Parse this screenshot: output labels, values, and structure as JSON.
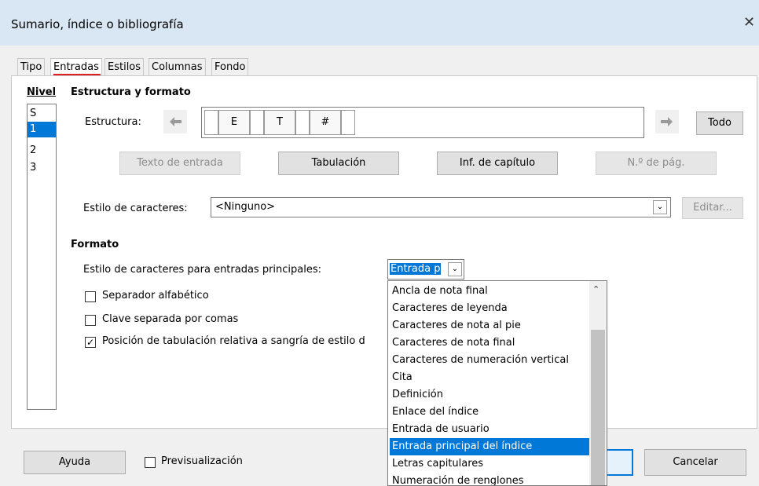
{
  "window": {
    "title": "Sumario, índice o bibliografía",
    "close_glyph": "✕"
  },
  "tabs": [
    {
      "label": "Tipo",
      "active": false
    },
    {
      "label": "Entradas",
      "active": true
    },
    {
      "label": "Estilos",
      "active": false
    },
    {
      "label": "Columnas",
      "active": false
    },
    {
      "label": "Fondo",
      "active": false
    }
  ],
  "levels": {
    "label": "Nivel",
    "items": [
      "S",
      "1",
      "2",
      "3"
    ],
    "selected": "1"
  },
  "structure": {
    "heading": "Estructura y formato",
    "label": "Estructura:",
    "tokens": [
      "E",
      "T",
      "#"
    ],
    "all_button": "Todo",
    "entry_text_button": "Texto de entrada",
    "tab_button": "Tabulación",
    "chapter_button": "Inf. de capítulo",
    "page_button": "N.º de pág.",
    "char_style_label": "Estilo de caracteres:",
    "char_style_value": "<Ninguno>",
    "edit_button": "Editar..."
  },
  "format": {
    "heading": "Formato",
    "main_entries_label": "Estilo de caracteres para entradas principales:",
    "main_entries_value": "Entrada p",
    "checkboxes": [
      {
        "label": "Separador alfabético",
        "checked": false
      },
      {
        "label": "Clave separada por comas",
        "checked": false
      },
      {
        "label": "Posición de tabulación relativa a sangría de estilo d",
        "checked": true
      }
    ]
  },
  "dropdown": {
    "options": [
      "Ancla de nota final",
      "Caracteres de leyenda",
      "Caracteres de nota al pie",
      "Caracteres de nota final",
      "Caracteres de numeración vertical",
      "Cita",
      "Definición",
      "Enlace del índice",
      "Entrada de usuario",
      "Entrada principal del índice",
      "Letras capitulares",
      "Numeración de renglones"
    ],
    "selected": "Entrada principal del índice"
  },
  "footer": {
    "help_button": "Ayuda",
    "preview_label": "Previsualización",
    "preview_checked": false,
    "cancel_button": "Cancelar"
  },
  "colors": {
    "selection": "#0078d7",
    "titlebar": "#d9e6f3",
    "tab_accent": "#e02020"
  }
}
